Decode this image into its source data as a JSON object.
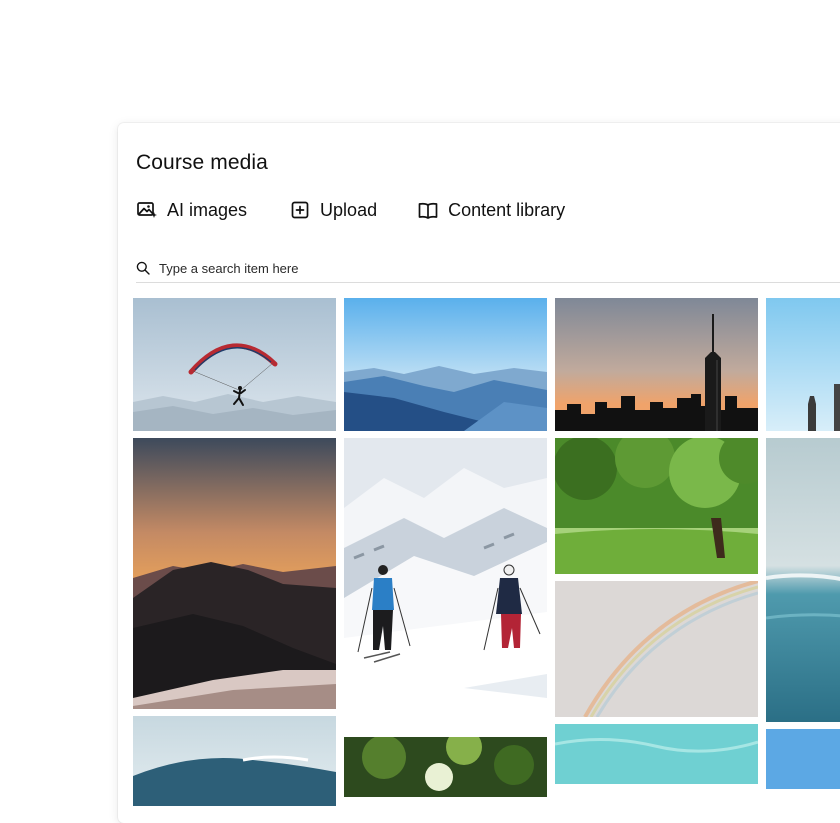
{
  "panel": {
    "title": "Course media",
    "tabs": [
      {
        "label": "AI images",
        "icon": "ai-image-icon"
      },
      {
        "label": "Upload",
        "icon": "plus-square-icon"
      },
      {
        "label": "Content library",
        "icon": "book-icon"
      }
    ],
    "search": {
      "placeholder": "Type a search item here",
      "icon": "search-icon"
    }
  },
  "gallery": {
    "images": [
      {
        "subject": "paraglider",
        "icon": "paraglider-image"
      },
      {
        "subject": "blue-mountains",
        "icon": "mountains-image"
      },
      {
        "subject": "city-skyline",
        "icon": "skyline-image"
      },
      {
        "subject": "statue",
        "icon": "statue-image"
      },
      {
        "subject": "sunset-mountain",
        "icon": "sunset-image"
      },
      {
        "subject": "skiers",
        "icon": "skiers-image"
      },
      {
        "subject": "tree",
        "icon": "tree-image"
      },
      {
        "subject": "ocean",
        "icon": "ocean-image"
      },
      {
        "subject": "rainbow",
        "icon": "rainbow-image"
      },
      {
        "subject": "wave",
        "icon": "wave-image"
      },
      {
        "subject": "forest-light",
        "icon": "forest-image"
      },
      {
        "subject": "turquoise-water",
        "icon": "water-image"
      },
      {
        "subject": "blue-sky",
        "icon": "sky-image"
      }
    ]
  }
}
